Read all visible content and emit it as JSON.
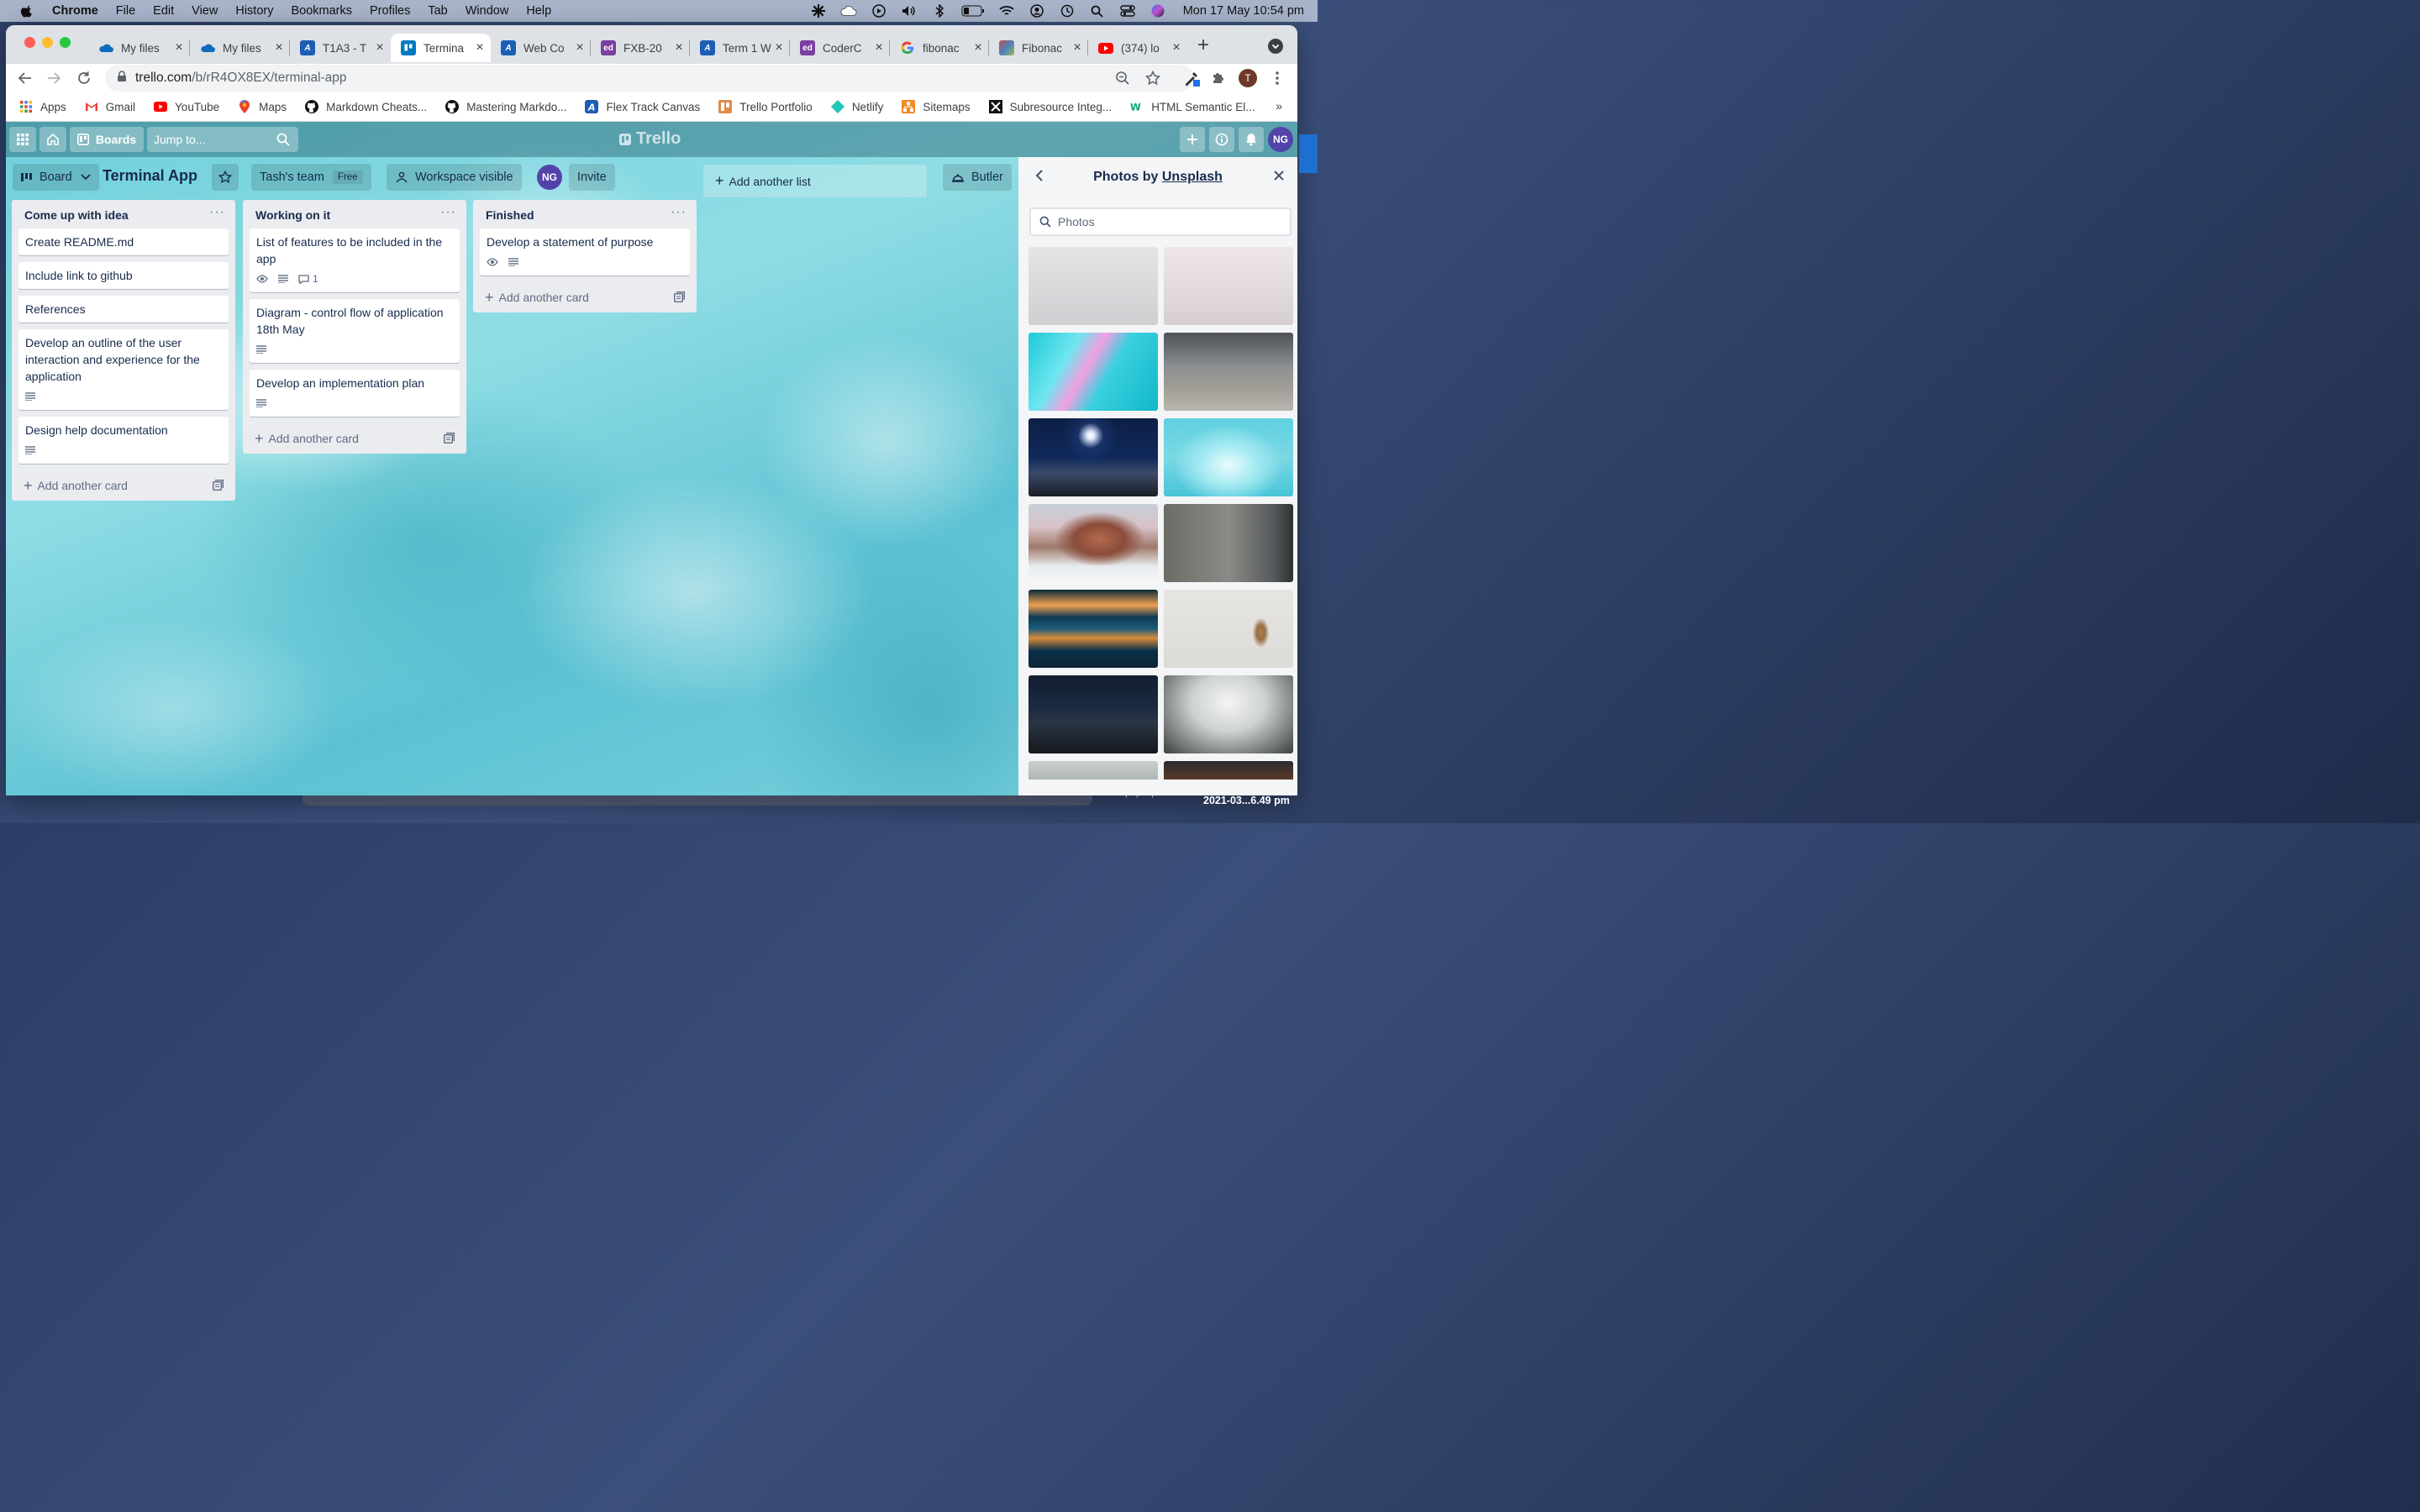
{
  "menubar": {
    "app": "Chrome",
    "items": [
      "File",
      "Edit",
      "View",
      "History",
      "Bookmarks",
      "Profiles",
      "Tab",
      "Window",
      "Help"
    ],
    "clock": "Mon 17 May  10:54 pm"
  },
  "tabs": [
    {
      "title": "My files",
      "favicon": "onedrive-icon",
      "color": "#0f6cbd"
    },
    {
      "title": "My files",
      "favicon": "onedrive-icon",
      "color": "#0f6cbd"
    },
    {
      "title": "T1A3 - T",
      "favicon": "canvas-icon",
      "color": "#1a5fb4"
    },
    {
      "title": "Termina",
      "favicon": "trello-icon",
      "color": "#0079bf"
    },
    {
      "title": "Web Co",
      "favicon": "canvas-icon",
      "color": "#1a5fb4"
    },
    {
      "title": "FXB-20",
      "favicon": "ed-icon",
      "color": "#7b3fa0"
    },
    {
      "title": "Term 1 W",
      "favicon": "canvas-icon",
      "color": "#1a5fb4"
    },
    {
      "title": "CoderC",
      "favicon": "ed-icon",
      "color": "#7b3fa0"
    },
    {
      "title": "fibonac",
      "favicon": "google-icon",
      "color": "#4285f4"
    },
    {
      "title": "Fibonac",
      "favicon": "wiki-icon",
      "color": "#888888"
    },
    {
      "title": "(374) lo",
      "favicon": "youtube-icon",
      "color": "#ff0000"
    }
  ],
  "address": {
    "host": "trello.com",
    "path": "/b/rR4OX8EX/terminal-app"
  },
  "profile_initial": "T",
  "bookmarks": [
    {
      "label": "Apps",
      "icon": "apps-grid-icon"
    },
    {
      "label": "Gmail",
      "icon": "gmail-icon"
    },
    {
      "label": "YouTube",
      "icon": "youtube-icon"
    },
    {
      "label": "Maps",
      "icon": "maps-icon"
    },
    {
      "label": "Markdown Cheats...",
      "icon": "github-icon"
    },
    {
      "label": "Mastering Markdo...",
      "icon": "github-icon"
    },
    {
      "label": "Flex Track Canvas",
      "icon": "canvas-icon"
    },
    {
      "label": "Trello Portfolio",
      "icon": "trello-icon"
    },
    {
      "label": "Netlify",
      "icon": "netlify-icon"
    },
    {
      "label": "Sitemaps",
      "icon": "sitemaps-icon"
    },
    {
      "label": "Subresource Integ...",
      "icon": "srihash-icon"
    },
    {
      "label": "HTML Semantic El...",
      "icon": "w3-icon"
    }
  ],
  "bookmarks_more": "»",
  "trello": {
    "boards_label": "Boards",
    "jump_placeholder": "Jump to...",
    "logo": "Trello",
    "member_initials": "NG",
    "board": {
      "view_label": "Board",
      "title": "Terminal App",
      "team": "Tash's team",
      "team_badge": "Free",
      "visibility": "Workspace visible",
      "invite": "Invite",
      "butler": "Butler"
    },
    "lists": [
      {
        "title": "Come up with idea",
        "cards": [
          {
            "text": "Create README.md"
          },
          {
            "text": "Include link to github"
          },
          {
            "text": "References"
          },
          {
            "text": "Develop an outline of the user interaction and experience for the application"
          },
          {
            "text": "Design help documentation"
          }
        ]
      },
      {
        "title": "Working on it",
        "cards": [
          {
            "text": "List of features to be included in the app",
            "comments": "1"
          },
          {
            "text": "Diagram - control flow of application 18th May"
          },
          {
            "text": "Develop an implementation plan"
          }
        ]
      },
      {
        "title": "Finished",
        "cards": [
          {
            "text": "Develop a statement of purpose"
          }
        ]
      }
    ],
    "add_card_label": "Add another card",
    "add_list_label": "Add another list",
    "list_menu": "···",
    "sidebar": {
      "title_prefix": "Photos by ",
      "title_link": "Unsplash",
      "search_placeholder": "Photos"
    }
  },
  "dock_label": "2021-03...6.49 pm",
  "dock_faded": "0 pay clips"
}
